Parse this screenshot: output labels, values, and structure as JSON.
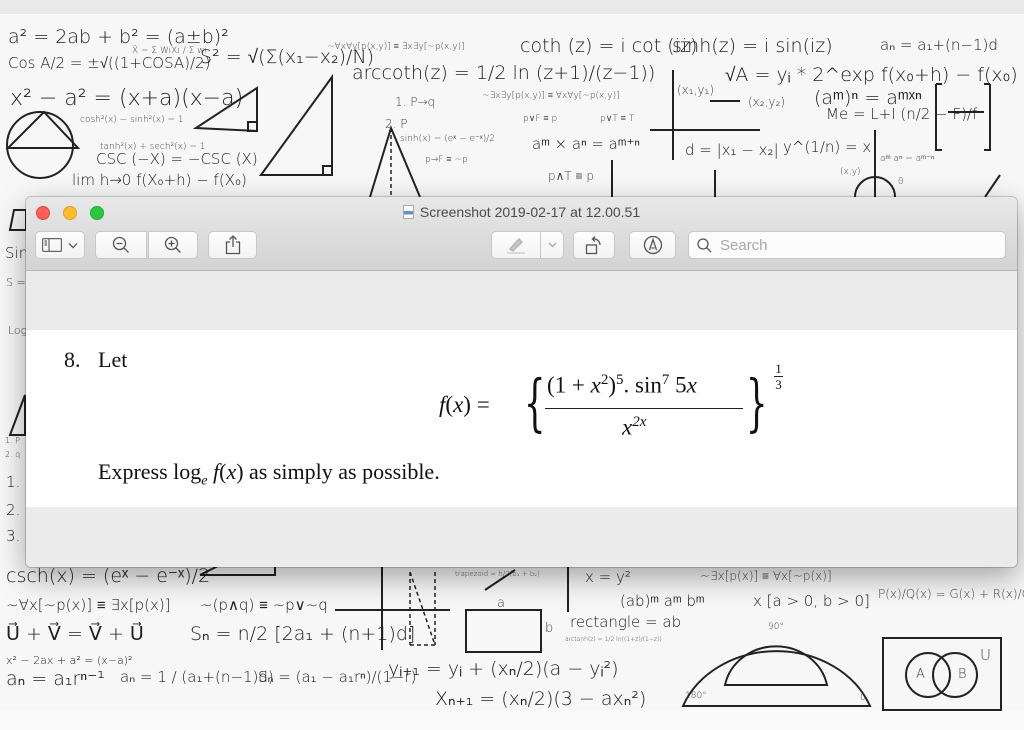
{
  "window": {
    "title": "Screenshot 2019-02-17 at 12.00.51",
    "title_icon": "image-document-icon",
    "traffic_lights": {
      "close_color": "#fc5f57",
      "minimize_color": "#fdbc2e",
      "maximize_color": "#28c840"
    }
  },
  "toolbar": {
    "buttons": [
      {
        "name": "sidebar-toggle",
        "icon": "sidebar-icon",
        "has_dropdown": true
      },
      {
        "name": "zoom-out",
        "icon": "zoom-out-icon"
      },
      {
        "name": "zoom-in",
        "icon": "zoom-in-icon"
      },
      {
        "name": "share",
        "icon": "share-icon"
      },
      {
        "name": "markup-highlight",
        "icon": "pen-icon",
        "has_dropdown": true,
        "disabled": true
      },
      {
        "name": "rotate",
        "icon": "rotate-left-icon"
      },
      {
        "name": "markup",
        "icon": "markup-pen-circle-icon"
      }
    ],
    "search": {
      "placeholder": "Search",
      "value": ""
    }
  },
  "document": {
    "question_number": "8.",
    "intro": "Let",
    "formula": {
      "lhs": "f(x) =",
      "numerator": "(1 + x²)⁵. sin⁷ 5x",
      "denominator": "x²ˣ",
      "exponent_numerator": "1",
      "exponent_denominator": "3",
      "lhs_parts": {
        "f": "f",
        "open": "(",
        "x": "x",
        "close": ")",
        "eq": "="
      },
      "num_parts": {
        "a": "(1 + ",
        "x": "x",
        "sq": "2",
        "b": ")",
        "five": "5",
        "c": ". sin",
        "seven": "7",
        "d": " 5",
        "x2": "x"
      },
      "den_parts": {
        "x": "x",
        "pow": "2x"
      }
    },
    "instruction": {
      "before": "Express log",
      "subscript": "e",
      "func": "f",
      "after_func": "(",
      "var": "x",
      "after": ") as simply as possible."
    }
  },
  "background": {
    "description": "handwritten math formulas whiteboard",
    "formulas_top": [
      "a² = 2ab + b² = (a±b)²",
      "X̄ = Σ WiXi / Σ wi",
      "S² = √(Σ(x₁−x₂)/N)",
      "~∀x∀y[p(x,y)] ≡ ∃x∃y[~p(x,y)]",
      "coth (z) = i cot (iz)",
      "sinh(z) = i sin(iz)",
      "aₙ = a₁+(n−1)d",
      "Cos A/2 = ±√((1+COSA)/2)",
      "arccoth(z) = 1/2 ln (z+1)/(z−1))",
      "√A = yᵢ * 2^exp f(x₀+h) − f(x₀)",
      "x² − a² = (x+a)(x−a)",
      "1. P→q",
      "2. P",
      "~∃x∃y[p(x,y)] ≡ ∀x∀y[~p(x,y)]",
      "(x₁,y₁)",
      "(x₂,y₂)",
      "(aᵐ)ⁿ = aᵐˣⁿ",
      "Me = L+I (n/2 − F)/f",
      "cosh²(x) − sinh²(x) = 1",
      "tanh²(x) + sech²(x) = 1",
      "sinh(x) = (eˣ − e⁻ˣ)/2",
      "p∨F ≡ p",
      "p∨T ≡ T",
      "aᵐ × aⁿ = aᵐ⁺ⁿ",
      "d = |x₁ − x₂|",
      "y^(1/n) = x",
      "CSC (−X) = −CSC (X)",
      "p→F ≡ ~p",
      "p∧T ≡ p",
      "lim h→0 f(X₀+h) − f(X₀)",
      "aᵐ aⁿ = aᵐ⁻ⁿ",
      "(x,y)",
      "θ"
    ],
    "formulas_left": [
      "Sin",
      "S =",
      "Log",
      "1. P",
      "2. q",
      "1.",
      "2.",
      "3."
    ],
    "formulas_bottom": [
      "csch(x) = (eˣ − e⁻ˣ)/2",
      "~∀x[~p(x)] ≡ ∃x[p(x)]",
      "~(p∧q) ≡ ~p∨~q",
      "U⃗ + V⃗ = V⃗ + U⃗",
      "Sₙ = n/2 [2a₁ + (n+1)d]",
      "x² − 2ax + a² = (x−a)²",
      "aₙ = a₁rⁿ⁻¹",
      "aₙ = 1 / (a₁+(n−1)d)",
      "Sₙ = (a₁ − a₁rⁿ)/(1−r)",
      "yᵢ₊₁ = yᵢ + (xₙ/2)(a − yᵢ²)",
      "Xₙ₊₁ = (xₙ/2)(3 − axₙ²)",
      "trapezoid = h/2(b₁ + b₂)",
      "x = y²",
      "~∃x[p(x)] ≡ ∀x[~p(x)]",
      "(ab)ᵐ aᵐ bᵐ",
      "x [a > 0, b > 0]",
      "P(x)/Q(x) = G(x) + R(x)/Q(x)",
      "rectangle = ab",
      "arctanh(z) = 1/2 ln((1+z)/(1−z))",
      "a",
      "b",
      "90°",
      "180°",
      "0",
      "A",
      "B",
      "U"
    ]
  }
}
